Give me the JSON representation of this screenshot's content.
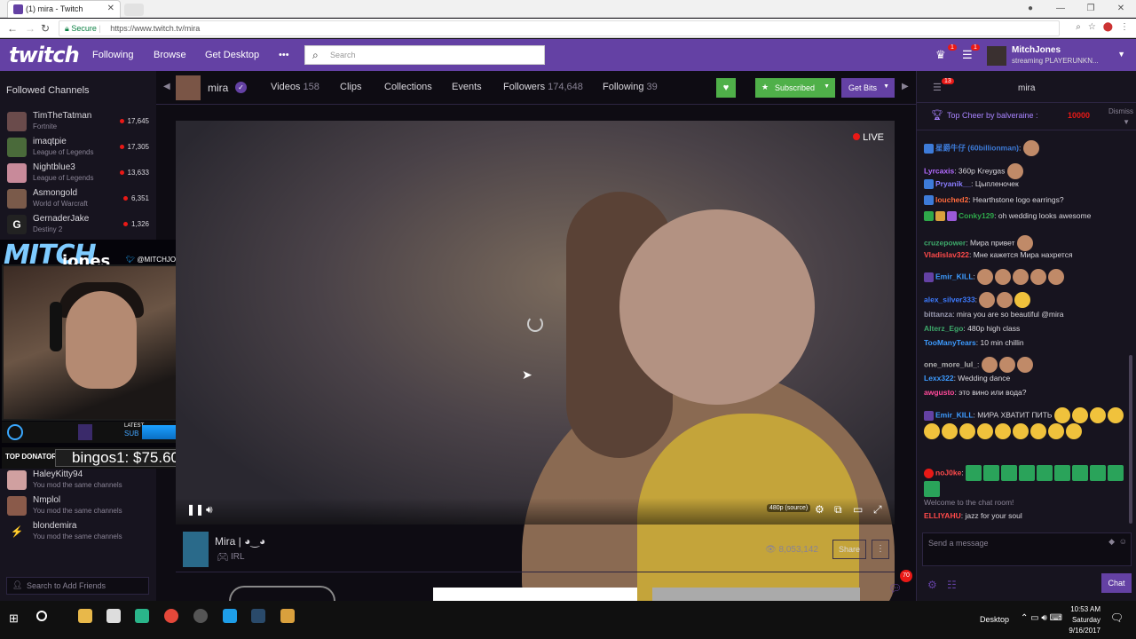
{
  "browser": {
    "tab_title": "(1) mira - Twitch",
    "secure_label": "Secure",
    "url": "https://www.twitch.tv/mira"
  },
  "topnav": {
    "logo": "twitch",
    "links": [
      "Following",
      "Browse",
      "Get Desktop",
      "•••"
    ],
    "search_placeholder": "Search",
    "user_name": "MitchJones",
    "user_status": "streaming PLAYERUNKN..."
  },
  "sidebar": {
    "header": "Followed Channels",
    "channels": [
      {
        "name": "TimTheTatman",
        "game": "Fortnite",
        "viewers": "17,645"
      },
      {
        "name": "imaqtpie",
        "game": "League of Legends",
        "viewers": "17,305"
      },
      {
        "name": "Nightblue3",
        "game": "League of Legends",
        "viewers": "13,633"
      },
      {
        "name": "Asmongold",
        "game": "World of Warcraft",
        "viewers": "6,351"
      },
      {
        "name": "GernaderJake",
        "game": "Destiny 2",
        "viewers": "1,326"
      }
    ],
    "friends": [
      {
        "name": "HaleyKitty94",
        "status": "You mod the same channels"
      },
      {
        "name": "Nmplol",
        "status": "You mod the same channels"
      },
      {
        "name": "blondemira",
        "status": "You mod the same channels"
      }
    ],
    "add_friends_placeholder": "Search to Add Friends"
  },
  "overlay": {
    "brand_top": "MITCH",
    "brand_bottom": "jones",
    "twitter": "@MITCHJONEZ",
    "latest_label": "LATEST",
    "sub_label": "SUB",
    "top_donator_label": "TOP DONATOR",
    "top_donator_value": "bingos1: $75.60"
  },
  "channel": {
    "name": "mira",
    "tabs": [
      {
        "label": "Videos",
        "count": "158"
      },
      {
        "label": "Clips",
        "count": ""
      },
      {
        "label": "Collections",
        "count": ""
      },
      {
        "label": "Events",
        "count": ""
      },
      {
        "label": "Followers",
        "count": "174,648"
      },
      {
        "label": "Following",
        "count": "39"
      }
    ],
    "subscribed_label": "Subscribed",
    "get_bits_label": "Get Bits"
  },
  "player": {
    "live_label": "LIVE",
    "quality": "480p (source)"
  },
  "stream_info": {
    "title": "Mira | ◕‿◕",
    "game": "IRL",
    "viewers": "8,053,142",
    "share_label": "Share",
    "more_label": "⋮",
    "notif_count": "70"
  },
  "chat": {
    "header": "mira",
    "top_cheer_label": "Top Cheer by balveraine :",
    "top_cheer_amount": "10000",
    "dismiss_label": "Dismiss",
    "messages": [
      {
        "user": "星爵牛仔 (60billionman)",
        "text": ":",
        "color": "#3d7bd9"
      },
      {
        "user": "Lyrcaxis",
        "text": "360p Kreygas",
        "color": "#b36bff"
      },
      {
        "user": "Pryanik__",
        "text": "Цыпленочек",
        "color": "#8a7dff"
      },
      {
        "user": "louched2",
        "text": "Hearthstone logo earrings?",
        "color": "#ff6a3d"
      },
      {
        "user": "Conky129",
        "text": "oh wedding looks awesome",
        "color": "#2ea84a"
      },
      {
        "user": "cruzepower",
        "text": "Мира привет",
        "color": "#3da86a"
      },
      {
        "user": "Vladislav322",
        "text": "Мне кажется Мира нахрется",
        "color": "#ff4a4a"
      },
      {
        "user": "Emir_KILL",
        "text": ":",
        "color": "#3d9bff"
      },
      {
        "user": "alex_silver333",
        "text": ":",
        "color": "#3d7bff"
      },
      {
        "user": "bittanza",
        "text": "mira you are so beautiful @mira",
        "color": "#9a9ab0"
      },
      {
        "user": "Alterz_Ego",
        "text": "480p high class",
        "color": "#3da86a"
      },
      {
        "user": "TooManyTears",
        "text": "10 min chillin",
        "color": "#3d9bff"
      },
      {
        "user": "one_more_lul_",
        "text": ":",
        "color": "#b0b0b0"
      },
      {
        "user": "Lexx322",
        "text": "Wedding dance",
        "color": "#3d9bff"
      },
      {
        "user": "awgusto",
        "text": "это вино или вода?",
        "color": "#ff4a9a"
      },
      {
        "user": "Emir_KILL",
        "text": "МИРА ХВАТИТ ПИТЬ",
        "color": "#3d9bff"
      },
      {
        "user": "noJ0ke",
        "text": ":",
        "color": "#ff4a4a"
      },
      {
        "user": "",
        "text": "Welcome to the chat room!",
        "color": "#898395"
      },
      {
        "user": "ELLIYAHU",
        "text": "jazz for your soul",
        "color": "#ff4a4a"
      }
    ],
    "input_placeholder": "Send a message",
    "chat_button": "Chat"
  },
  "taskbar": {
    "desktop_label": "Desktop",
    "time": "10:53 AM",
    "day": "Saturday",
    "date": "9/16/2017"
  }
}
